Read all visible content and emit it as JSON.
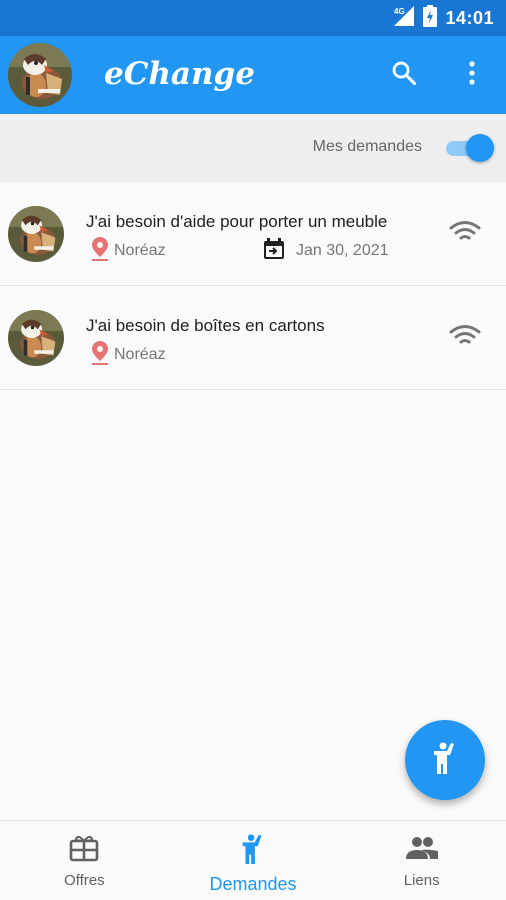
{
  "status_bar": {
    "network": "4G",
    "time": "14:01"
  },
  "app_bar": {
    "title": "eChange",
    "icons": [
      "search-icon",
      "more-vert-icon"
    ]
  },
  "filter": {
    "label": "Mes demandes",
    "toggle_on": true
  },
  "requests": [
    {
      "title": "J'ai besoin d'aide pour porter un meuble",
      "location": "Noréaz",
      "date": "Jan 30, 2021"
    },
    {
      "title": "J'ai besoin de boîtes en cartons",
      "location": "Noréaz"
    }
  ],
  "bottom_nav": {
    "items": [
      {
        "label": "Offres",
        "icon": "gift-icon"
      },
      {
        "label": "Demandes",
        "icon": "hand-raised-person-icon",
        "active": true
      },
      {
        "label": "Liens",
        "icon": "people-icon"
      }
    ]
  },
  "colors": {
    "primary": "#2196f3",
    "primary_dark": "#1976d2",
    "pin": "#e57373",
    "muted": "#757575"
  }
}
